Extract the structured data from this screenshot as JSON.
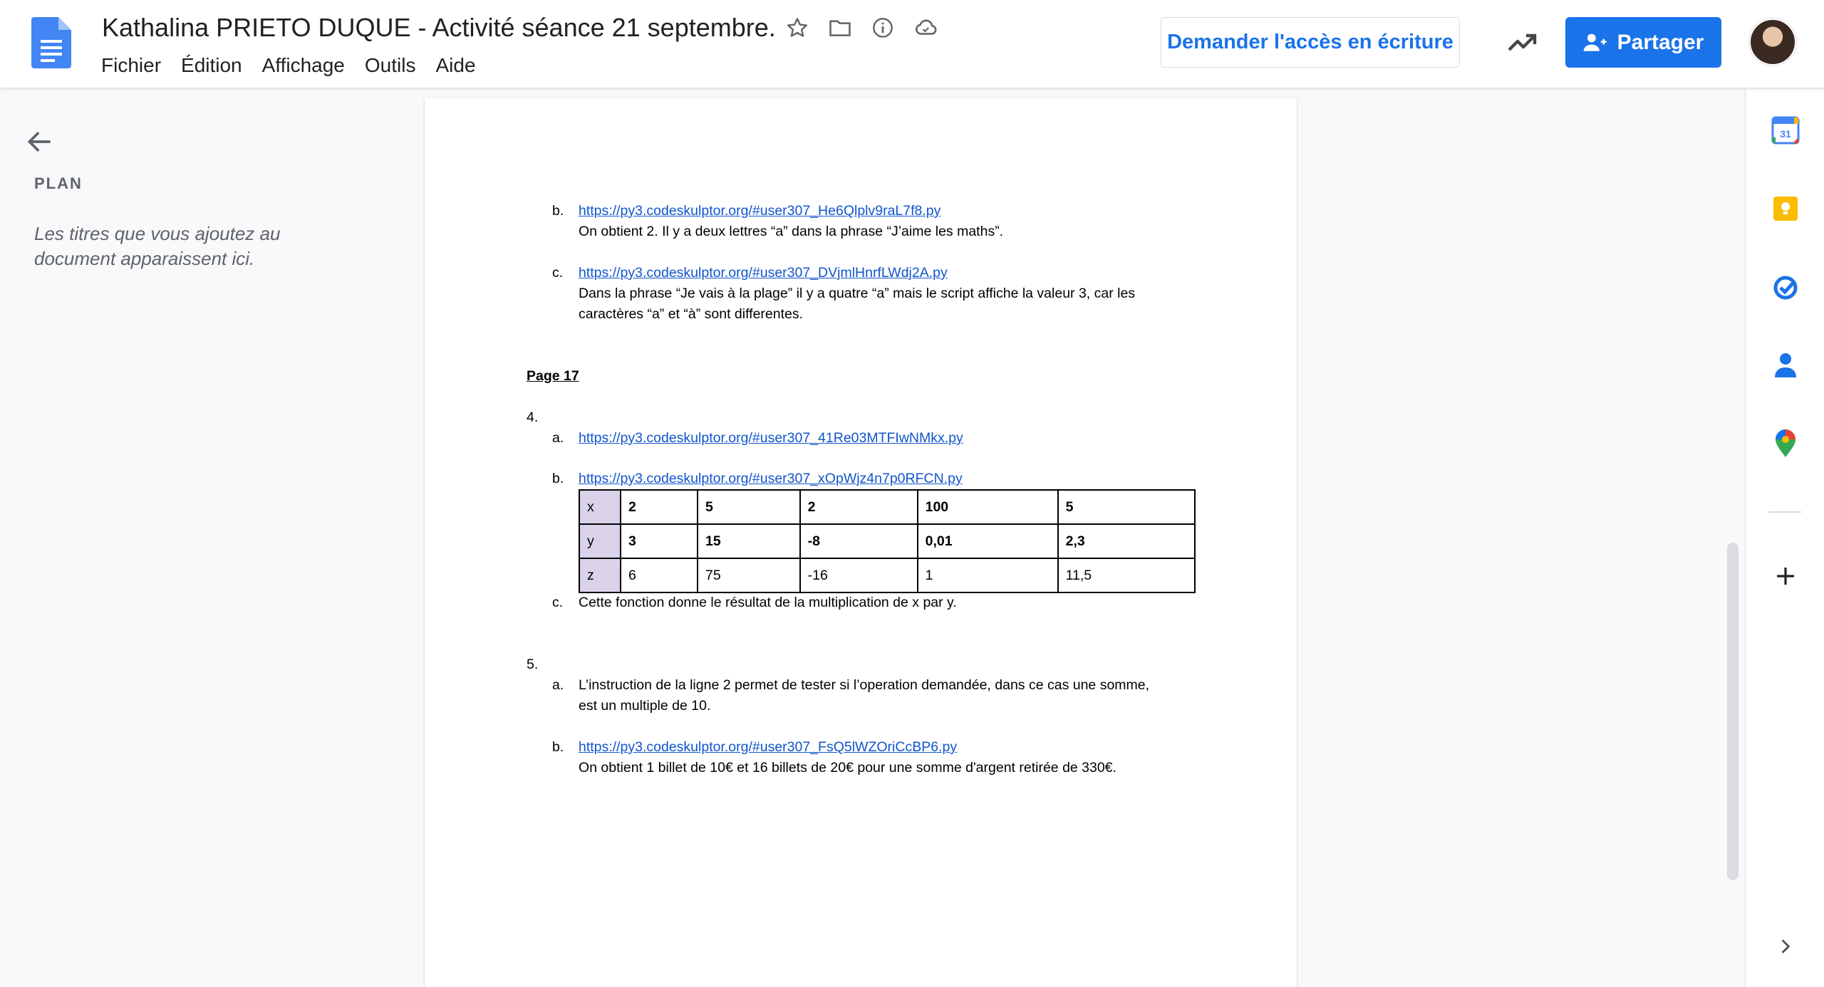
{
  "header": {
    "title": "Kathalina PRIETO DUQUE - Activité séance 21 septembre.",
    "menu": [
      "Fichier",
      "Édition",
      "Affichage",
      "Outils",
      "Aide"
    ],
    "request_access_label": "Demander l'accès en écriture",
    "share_label": "Partager",
    "icons": [
      "star-icon",
      "folder-icon",
      "info-icon",
      "cloud-icon",
      "trending-icon"
    ],
    "brand_color": "#1a73e8"
  },
  "outline": {
    "title": "PLAN",
    "hint": "Les titres que vous ajoutez au document apparaissent ici."
  },
  "document": {
    "item_b_marker": "b.",
    "item_b_link": "https://py3.codeskulptor.org/#user307_He6Qlplv9raL7f8.py",
    "item_b_text": "On obtient 2. Il y a deux lettres “a” dans la phrase “J’aime les maths”.",
    "item_c_marker": "c.",
    "item_c_link": "https://py3.codeskulptor.org/#user307_DVjmlHnrfLWdj2A.py",
    "item_c_text_1": "Dans la phrase “Je vais à la plage” il y a quatre “a” mais le script affiche la valeur 3, car les",
    "item_c_text_2": "caractères “a” et “à” sont differentes.",
    "page_heading": "Page 17",
    "q4_marker": "4.",
    "q4a_marker": "a.",
    "q4a_link": "https://py3.codeskulptor.org/#user307_41Re03MTFIwNMkx.py",
    "q4b_marker": "b.",
    "q4b_link": "https://py3.codeskulptor.org/#user307_xOpWjz4n7p0RFCN.py",
    "table": {
      "rows": [
        {
          "label": "x",
          "cells": [
            "2",
            "5",
            "2",
            "100",
            "5"
          ]
        },
        {
          "label": "y",
          "cells": [
            "3",
            "15",
            "-8",
            "0,01",
            "2,3"
          ]
        },
        {
          "label": "z",
          "cells": [
            "6",
            "75",
            "-16",
            "1",
            "11,5"
          ]
        }
      ]
    },
    "q4c_marker": "c.",
    "q4c_text": "Cette fonction donne le résultat de la multiplication de x par y.",
    "q5_marker": "5.",
    "q5a_marker": "a.",
    "q5a_text_1": "L’instruction de la ligne 2 permet de tester si l’operation demandée, dans ce cas une somme,",
    "q5a_text_2": "est un multiple de 10.",
    "q5b_marker": "b.",
    "q5b_link": "https://py3.codeskulptor.org/#user307_FsQ5lWZOriCcBP6.py",
    "q5b_text": "On obtient 1 billet de 10€ et 16 billets de 20€ pour une somme d'argent retirée de 330€."
  },
  "side_panel": {
    "calendar_day": "31",
    "icons": [
      "calendar-icon",
      "keep-icon",
      "tasks-icon",
      "contacts-icon",
      "maps-icon",
      "add-icon",
      "expand-icon"
    ]
  }
}
